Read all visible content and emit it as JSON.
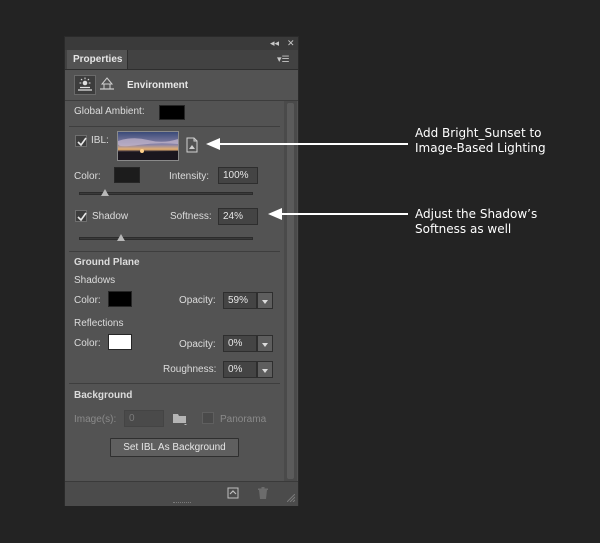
{
  "panel": {
    "tab_label": "Properties",
    "collapse_glyph": "◂◂",
    "close_glyph": "✕",
    "menu_glyph": "▾☰",
    "title": "Environment"
  },
  "global_ambient": {
    "label": "Global Ambient:",
    "color": "#000000"
  },
  "ibl": {
    "label": "IBL:",
    "checked": true
  },
  "color_row": {
    "label": "Color:",
    "color": "#1c1c1c",
    "intensity_label": "Intensity:",
    "intensity_value": "100%"
  },
  "shadow": {
    "label": "Shadow",
    "checked": true,
    "softness_label": "Softness:",
    "softness_value": "24%"
  },
  "ground_plane": {
    "title": "Ground Plane",
    "shadows_title": "Shadows",
    "shadows_color_label": "Color:",
    "shadows_color": "#000000",
    "shadows_opacity_label": "Opacity:",
    "shadows_opacity_value": "59%",
    "reflections_title": "Reflections",
    "reflections_color_label": "Color:",
    "reflections_color": "#ffffff",
    "reflections_opacity_label": "Opacity:",
    "reflections_opacity_value": "0%",
    "roughness_label": "Roughness:",
    "roughness_value": "0%"
  },
  "background": {
    "title": "Background",
    "images_label": "Image(s):",
    "images_value": "0",
    "panorama_label": "Panorama",
    "set_ibl_button": "Set IBL As Background"
  },
  "annotations": {
    "ibl_note_line1": "Add Bright_Sunset to",
    "ibl_note_line2": "Image-Based Lighting",
    "shadow_note_line1": "Adjust the Shadow’s",
    "shadow_note_line2": "Softness as well"
  }
}
